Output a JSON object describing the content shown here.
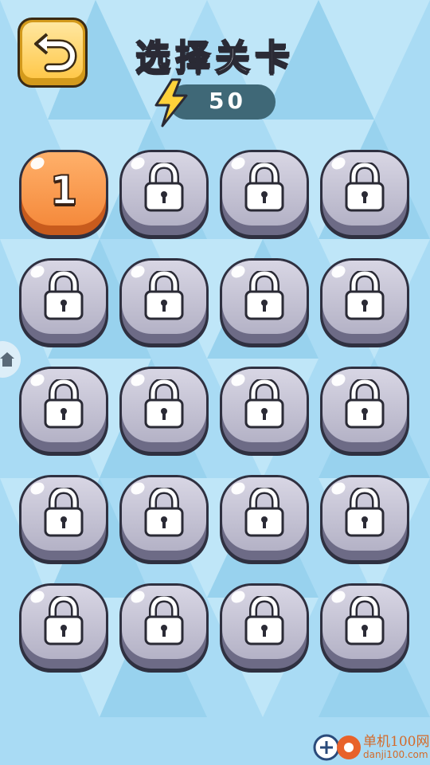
{
  "header": {
    "title": "选择关卡",
    "back_icon": "undo-arrow-icon",
    "energy_icon": "lightning-bolt-icon",
    "energy_value": "50"
  },
  "levels": [
    {
      "label": "1",
      "locked": false
    },
    {
      "label": "",
      "locked": true
    },
    {
      "label": "",
      "locked": true
    },
    {
      "label": "",
      "locked": true
    },
    {
      "label": "",
      "locked": true
    },
    {
      "label": "",
      "locked": true
    },
    {
      "label": "",
      "locked": true
    },
    {
      "label": "",
      "locked": true
    },
    {
      "label": "",
      "locked": true
    },
    {
      "label": "",
      "locked": true
    },
    {
      "label": "",
      "locked": true
    },
    {
      "label": "",
      "locked": true
    },
    {
      "label": "",
      "locked": true
    },
    {
      "label": "",
      "locked": true
    },
    {
      "label": "",
      "locked": true
    },
    {
      "label": "",
      "locked": true
    },
    {
      "label": "",
      "locked": true
    },
    {
      "label": "",
      "locked": true
    },
    {
      "label": "",
      "locked": true
    },
    {
      "label": "",
      "locked": true
    }
  ],
  "side_tab": {
    "icon": "house-icon"
  },
  "watermark": {
    "title": "单机100网",
    "url": "danji100.com"
  },
  "colors": {
    "background": "#a9dbf4",
    "unlocked_level": "#f58a3c",
    "locked_level": "#c4c2d4",
    "back_button": "#ffc84a",
    "energy_pill": "#3f6877"
  }
}
